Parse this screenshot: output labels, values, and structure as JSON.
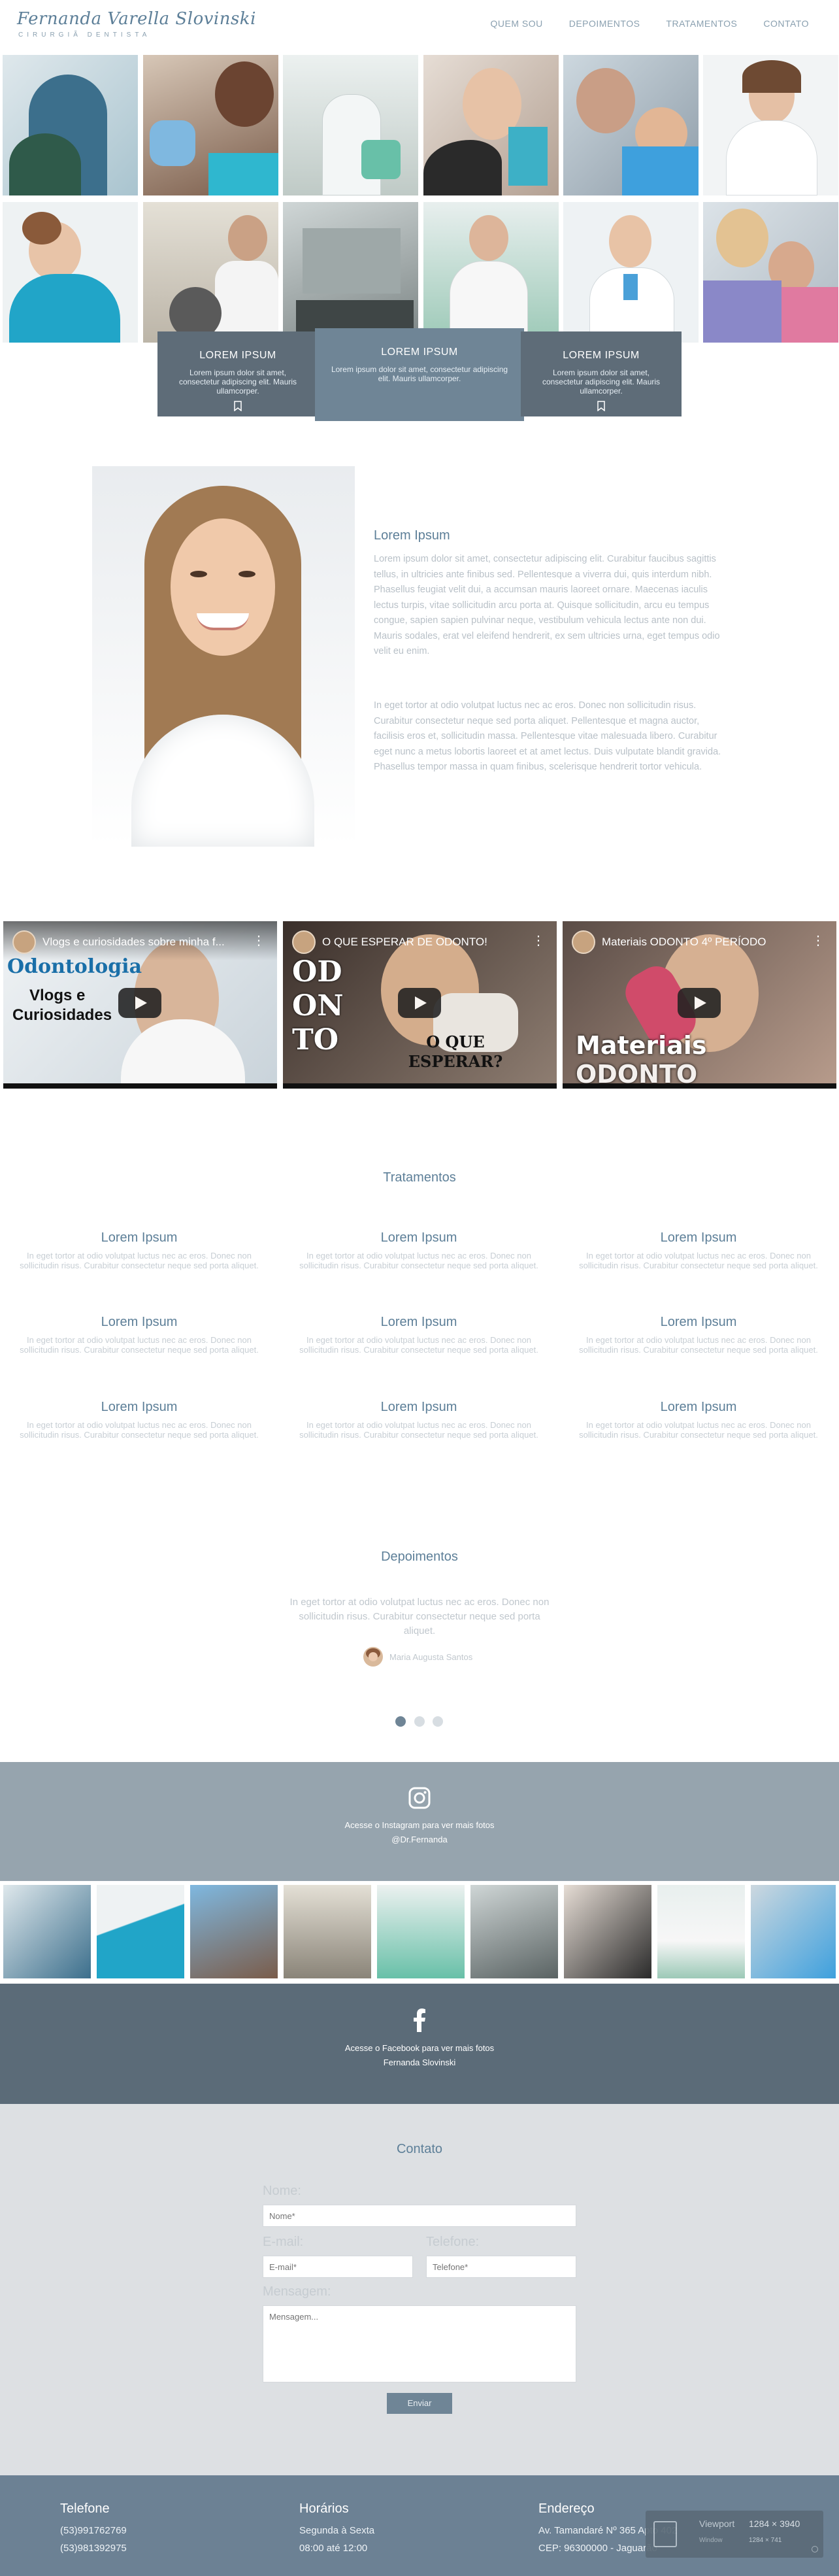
{
  "brand": {
    "name": "Fernanda Varella Slovinski",
    "subtitle": "CIRURGIÃ DENTISTA"
  },
  "nav": [
    {
      "label": "QUEM SOU"
    },
    {
      "label": "DEPOIMENTOS"
    },
    {
      "label": "TRATAMENTOS"
    },
    {
      "label": "CONTATO"
    }
  ],
  "cards": [
    {
      "title": "LOREM IPSUM",
      "text": "Lorem ipsum dolor sit amet, consectetur adipiscing elit. Mauris ullamcorper."
    },
    {
      "title": "LOREM IPSUM",
      "text": "Lorem ipsum dolor sit amet, consectetur adipiscing elit. Mauris ullamcorper."
    },
    {
      "title": "LOREM IPSUM",
      "text": "Lorem ipsum dolor sit amet, consectetur adipiscing elit. Mauris ullamcorper."
    }
  ],
  "about": {
    "title": "Lorem Ipsum",
    "p1": "Lorem ipsum dolor sit amet, consectetur adipiscing elit. Curabitur faucibus sagittis tellus, in ultricies ante finibus sed. Pellentesque a viverra dui, quis interdum nibh. Phasellus feugiat velit dui, a accumsan mauris laoreet ornare. Maecenas iaculis lectus turpis, vitae sollicitudin arcu porta at. Quisque sollicitudin, arcu eu tempus congue, sapien sapien pulvinar neque, vestibulum vehicula lectus ante non dui. Mauris sodales, erat vel eleifend hendrerit, ex sem ultricies urna, eget tempus odio velit eu enim.",
    "p2": "In eget tortor at odio volutpat luctus nec ac eros. Donec non sollicitudin risus. Curabitur consectetur neque sed porta aliquet. Pellentesque et magna auctor, facilisis eros et, sollicitudin massa. Pellentesque vitae malesuada libero. Curabitur eget nunc a metus lobortis laoreet et at amet lectus. Duis vulputate blandit gravida. Phasellus tempor massa in quam finibus, scelerisque hendrerit tortor vehicula."
  },
  "videos": [
    {
      "title": "Vlogs e curiosidades sobre minha f...",
      "overlay1": "Odontologia",
      "overlay2": "Vlogs e",
      "overlay3": "Curiosidades"
    },
    {
      "title": "O QUE ESPERAR DE ODONTO!",
      "overlay1": "OD",
      "overlay2": "ON",
      "overlay3": "TO",
      "overlay4": "O QUE",
      "overlay5": "ESPERAR?"
    },
    {
      "title": "Materiais ODONTO 4º PERÍODO",
      "overlay1": "Materiais",
      "overlay2": "ODONTO"
    }
  ],
  "treatments": {
    "title": "Tratamentos",
    "items": [
      {
        "title": "Lorem Ipsum",
        "text": "In eget tortor at odio volutpat luctus nec ac eros. Donec non sollicitudin risus. Curabitur consectetur neque sed porta aliquet."
      },
      {
        "title": "Lorem Ipsum",
        "text": "In eget tortor at odio volutpat luctus nec ac eros. Donec non sollicitudin risus. Curabitur consectetur neque sed porta aliquet."
      },
      {
        "title": "Lorem Ipsum",
        "text": "In eget tortor at odio volutpat luctus nec ac eros. Donec non sollicitudin risus. Curabitur consectetur neque sed porta aliquet."
      },
      {
        "title": "Lorem Ipsum",
        "text": "In eget tortor at odio volutpat luctus nec ac eros. Donec non sollicitudin risus. Curabitur consectetur neque sed porta aliquet."
      },
      {
        "title": "Lorem Ipsum",
        "text": "In eget tortor at odio volutpat luctus nec ac eros. Donec non sollicitudin risus. Curabitur consectetur neque sed porta aliquet."
      },
      {
        "title": "Lorem Ipsum",
        "text": "In eget tortor at odio volutpat luctus nec ac eros. Donec non sollicitudin risus. Curabitur consectetur neque sed porta aliquet."
      },
      {
        "title": "Lorem Ipsum",
        "text": "In eget tortor at odio volutpat luctus nec ac eros. Donec non sollicitudin risus. Curabitur consectetur neque sed porta aliquet."
      },
      {
        "title": "Lorem Ipsum",
        "text": "In eget tortor at odio volutpat luctus nec ac eros. Donec non sollicitudin risus. Curabitur consectetur neque sed porta aliquet."
      },
      {
        "title": "Lorem Ipsum",
        "text": "In eget tortor at odio volutpat luctus nec ac eros. Donec non sollicitudin risus. Curabitur consectetur neque sed porta aliquet."
      }
    ]
  },
  "testimonials": {
    "title": "Depoimentos",
    "text": "In eget tortor at odio volutpat luctus nec ac eros. Donec non sollicitudin risus. Curabitur consectetur neque sed porta aliquet.",
    "author": "Maria Augusta Santos",
    "active_slide": 1,
    "slides": 3
  },
  "instagram": {
    "line1": "Acesse o Instagram para ver mais fotos",
    "line2": "@Dr.Fernanda"
  },
  "facebook": {
    "line1": "Acesse o Facebook para ver mais fotos",
    "line2": "Fernanda Slovinski"
  },
  "contact": {
    "title": "Contato",
    "name_label": "Nome:",
    "name_placeholder": "Nome*",
    "email_label": "E-mail:",
    "email_placeholder": "E-mail*",
    "phone_label": "Telefone:",
    "phone_placeholder": "Telefone*",
    "message_label": "Mensagem:",
    "message_placeholder": "Mensagem...",
    "submit": "Enviar"
  },
  "footer": {
    "phone_title": "Telefone",
    "phone1": "(53)991762769",
    "phone2": "(53)981392975",
    "hours_title": "Horários",
    "hours1": "Segunda à Sexta",
    "hours2": "08:00 até 12:00",
    "address_title": "Endereço",
    "address1": "Av. Tamandaré Nº 365 Apto 402",
    "address2": "CEP: 96300000 - Jaguarão"
  },
  "viewport_badge": {
    "label1": "Viewport",
    "value1": "1284 × 3940",
    "label2": "Window",
    "value2": "1284 × 741"
  },
  "colors": {
    "accent": "#6f8596",
    "dark": "#5e6c78",
    "band1": "#96a4ae",
    "band2": "#5b6b78",
    "footer": "#6c8194"
  }
}
